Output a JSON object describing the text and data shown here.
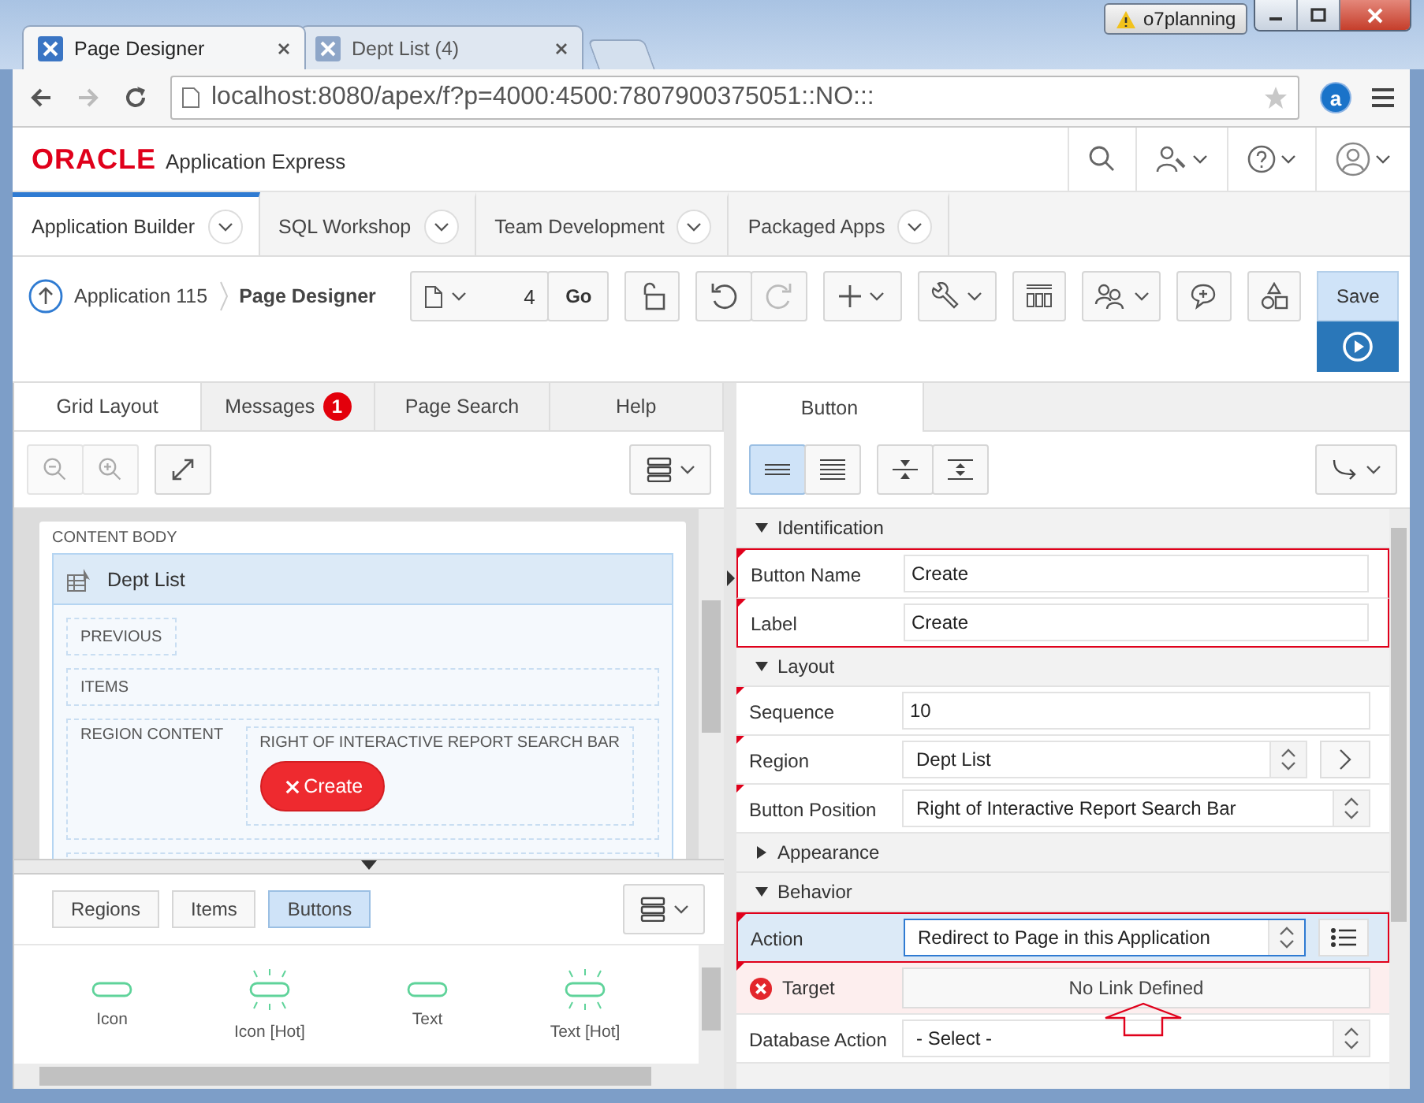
{
  "browser": {
    "tabs": [
      {
        "title": "Page Designer",
        "selected": true
      },
      {
        "title": "Dept List (4)",
        "selected": false
      }
    ],
    "profile": "o7planning",
    "url": "localhost:8080/apex/f?p=4000:4500:7807900375051::NO:::",
    "extension": "a"
  },
  "header": {
    "brand": "ORACLE",
    "product": "Application Express"
  },
  "nav_tabs": [
    {
      "label": "Application Builder",
      "selected": true
    },
    {
      "label": "SQL Workshop",
      "selected": false
    },
    {
      "label": "Team Development",
      "selected": false
    },
    {
      "label": "Packaged Apps",
      "selected": false
    }
  ],
  "toolbar": {
    "breadcrumb": [
      "Application 115",
      "Page Designer"
    ],
    "page_number": "4",
    "go": "Go",
    "save": "Save"
  },
  "left_panel": {
    "tabs": [
      {
        "label": "Grid Layout",
        "selected": true
      },
      {
        "label": "Messages",
        "badge": "1",
        "selected": false
      },
      {
        "label": "Page Search",
        "selected": false
      },
      {
        "label": "Help",
        "selected": false
      }
    ],
    "canvas": {
      "section": "CONTENT BODY",
      "region": "Dept List",
      "slots": [
        "PREVIOUS",
        "ITEMS"
      ],
      "region_content": "REGION CONTENT",
      "button_position": "RIGHT OF INTERACTIVE REPORT SEARCH BAR",
      "button": "Create"
    },
    "gallery_tabs": [
      {
        "label": "Regions",
        "selected": false
      },
      {
        "label": "Items",
        "selected": false
      },
      {
        "label": "Buttons",
        "selected": true
      }
    ],
    "gallery": [
      {
        "label": "Icon",
        "hot": false
      },
      {
        "label": "Icon [Hot]",
        "hot": true
      },
      {
        "label": "Text",
        "hot": false
      },
      {
        "label": "Text [Hot]",
        "hot": true
      }
    ]
  },
  "right_panel": {
    "tab": "Button",
    "groups": [
      {
        "title": "Identification",
        "expanded": true,
        "rows": [
          {
            "label": "Button Name",
            "kind": "text",
            "value": "Create",
            "required": true,
            "selected": false,
            "error": false,
            "outlined": true
          },
          {
            "label": "Label",
            "kind": "text",
            "value": "Create",
            "required": true,
            "selected": false,
            "error": false,
            "outlined": true
          }
        ]
      },
      {
        "title": "Layout",
        "expanded": true,
        "rows": [
          {
            "label": "Sequence",
            "kind": "text",
            "value": "10",
            "required": true,
            "selected": false,
            "error": false,
            "outlined": false
          },
          {
            "label": "Region",
            "kind": "select-nav",
            "value": "Dept List",
            "required": true,
            "selected": false,
            "error": false,
            "outlined": false
          },
          {
            "label": "Button Position",
            "kind": "select",
            "value": "Right of Interactive Report Search Bar",
            "required": true,
            "selected": false,
            "error": false,
            "outlined": false
          }
        ]
      },
      {
        "title": "Appearance",
        "expanded": false
      },
      {
        "title": "Behavior",
        "expanded": true,
        "rows": [
          {
            "label": "Action",
            "kind": "select-menu",
            "value": "Redirect to Page in this Application",
            "required": true,
            "selected": true,
            "error": false,
            "outlined": true
          },
          {
            "label": "Target",
            "kind": "link",
            "value": "No Link Defined",
            "required": true,
            "selected": false,
            "error": true,
            "outlined": false
          },
          {
            "label": "Database Action",
            "kind": "select",
            "value": "- Select -",
            "required": false,
            "selected": false,
            "error": false,
            "outlined": false
          }
        ]
      }
    ]
  }
}
